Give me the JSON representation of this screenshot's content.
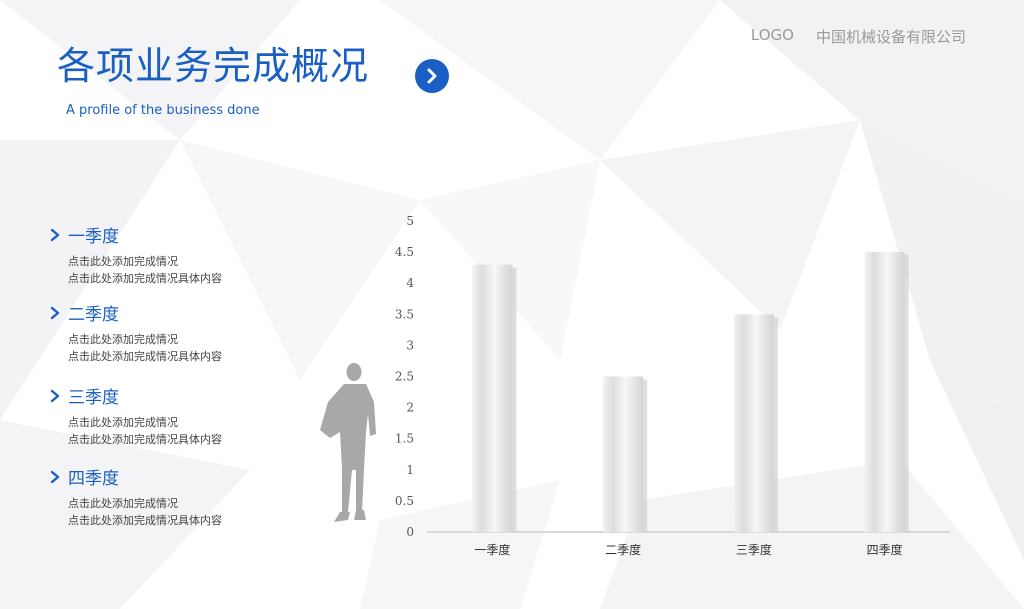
{
  "header": {
    "logo": "LOGO",
    "company": "中国机械设备有限公司",
    "title": "各项业务完成概况",
    "subtitle": "A profile of the business done"
  },
  "icons": {
    "title_button": "chevron-right-circle-icon",
    "quarter_bullet": "chevron-right-icon",
    "figure": "person-silhouette"
  },
  "colors": {
    "accent": "#1a5fc4",
    "text": "#444444",
    "muted": "#9a9a9a",
    "bar": "#e3e3e3",
    "bar_shadow": "#c4c4c4",
    "axis": "#d9d9d9",
    "tick_text": "#555555"
  },
  "quarters": [
    {
      "title": "一季度",
      "line1": "点击此处添加完成情况",
      "line2": "点击此处添加完成情况具体内容"
    },
    {
      "title": "二季度",
      "line1": "点击此处添加完成情况",
      "line2": "点击此处添加完成情况具体内容"
    },
    {
      "title": "三季度",
      "line1": "点击此处添加完成情况",
      "line2": "点击此处添加完成情况具体内容"
    },
    {
      "title": "四季度",
      "line1": "点击此处添加完成情况",
      "line2": "点击此处添加完成情况具体内容"
    }
  ],
  "chart_data": {
    "type": "bar",
    "categories": [
      "一季度",
      "二季度",
      "三季度",
      "四季度"
    ],
    "values": [
      4.3,
      2.5,
      3.5,
      4.5
    ],
    "ylim": [
      0,
      5
    ],
    "yticks": [
      "0",
      "0.5",
      "1",
      "1.5",
      "2",
      "2.5",
      "3",
      "3.5",
      "4",
      "4.5",
      "5"
    ],
    "grid": false,
    "legend": "none"
  }
}
